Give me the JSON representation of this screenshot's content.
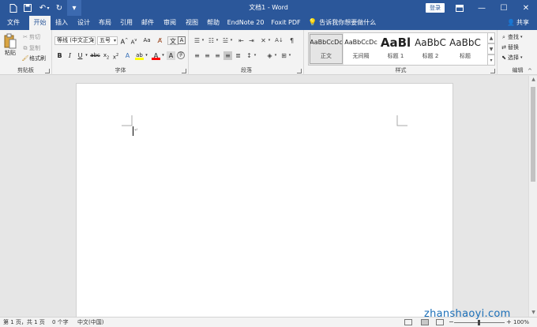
{
  "titlebar": {
    "title": "文档1 - Word",
    "login_label": "登录",
    "qa_icons": [
      "file-icon",
      "save-icon",
      "undo-icon",
      "redo-icon",
      "customize-icon"
    ]
  },
  "tabs": [
    {
      "label": "文件"
    },
    {
      "label": "开始"
    },
    {
      "label": "插入"
    },
    {
      "label": "设计"
    },
    {
      "label": "布局"
    },
    {
      "label": "引用"
    },
    {
      "label": "邮件"
    },
    {
      "label": "审阅"
    },
    {
      "label": "视图"
    },
    {
      "label": "帮助"
    },
    {
      "label": "EndNote 20"
    },
    {
      "label": "Foxit PDF"
    }
  ],
  "active_tab": "开始",
  "tell_me": "告诉我你想要做什么",
  "share": "共享",
  "clipboard": {
    "paste": "粘贴",
    "cut": "剪切",
    "copy": "复制",
    "format_painter": "格式刷",
    "label": "剪贴板"
  },
  "font": {
    "font_name": "等线 (中文正文",
    "font_size": "五号",
    "label": "字体",
    "wen": "文",
    "change_case": "Aa"
  },
  "paragraph": {
    "label": "段落"
  },
  "styles": {
    "label": "样式",
    "items": [
      {
        "preview": "AaBbCcDc",
        "name": "正文"
      },
      {
        "preview": "AaBbCcDc",
        "name": "无间隔"
      },
      {
        "preview": "AaBl",
        "name": "标题 1"
      },
      {
        "preview": "AaBbC",
        "name": "标题 2"
      },
      {
        "preview": "AaBbC",
        "name": "标题"
      }
    ]
  },
  "editing": {
    "label": "编辑",
    "find": "查找",
    "replace": "替换",
    "select": "选择"
  },
  "statusbar": {
    "page": "第 1 页，共 1 页",
    "words": "0 个字",
    "language": "中文(中国)",
    "zoom": "100%"
  },
  "watermark": "zhanshaoyi.com",
  "colors": {
    "brand": "#2b579a",
    "ribbon": "#f3f3f3",
    "highlight": "#ffff00",
    "font_color": "#ff0000"
  }
}
